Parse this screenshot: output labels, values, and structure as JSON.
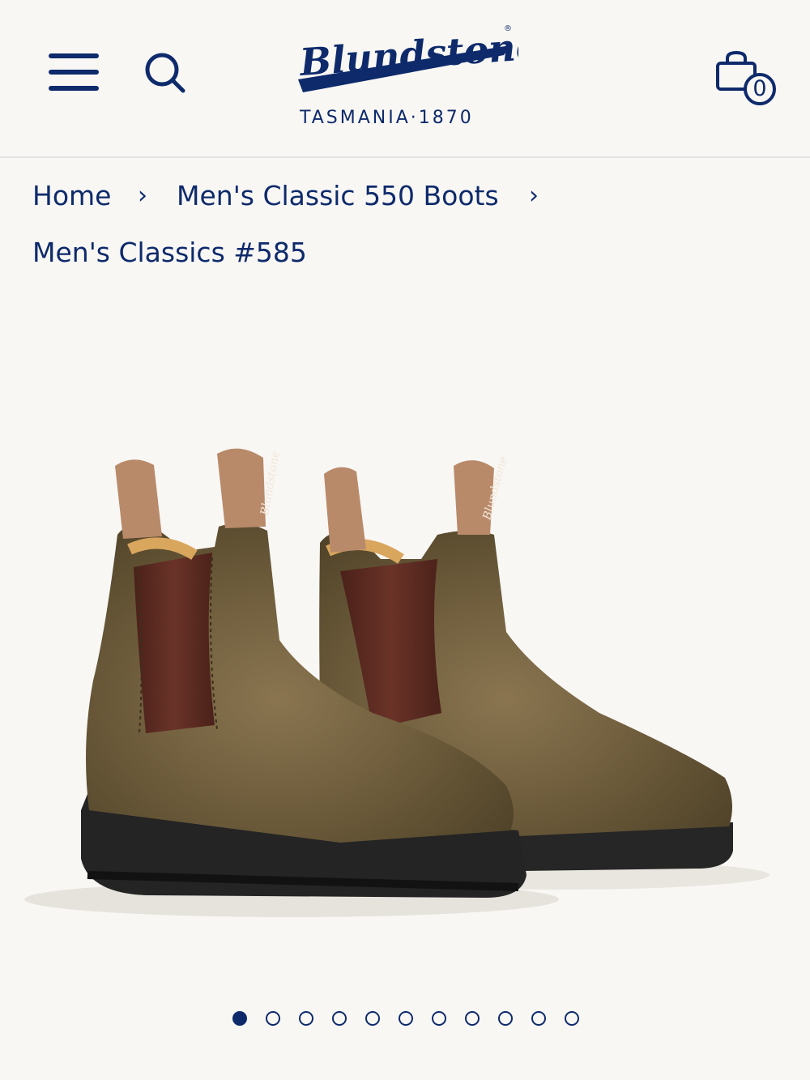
{
  "header": {
    "brand": "Blundstone",
    "tagline": "TASMANIA·1870",
    "cart_count": "0",
    "menu_icon": "hamburger-menu-icon",
    "search_icon": "search-icon",
    "cart_icon": "shopping-bag-icon"
  },
  "breadcrumb": {
    "items": [
      {
        "label": "Home"
      },
      {
        "label": "Men's Classic 550 Boots"
      },
      {
        "label": "Men's Classics #585"
      }
    ],
    "separator": "›"
  },
  "gallery": {
    "image_count": 11,
    "active_index": 0
  },
  "colors": {
    "brand_navy": "#0e2a6b",
    "background": "#f8f7f4",
    "leather_brown": "#6e5a3c",
    "elastic": "#5b2d24",
    "sole": "#2a2a2a"
  }
}
